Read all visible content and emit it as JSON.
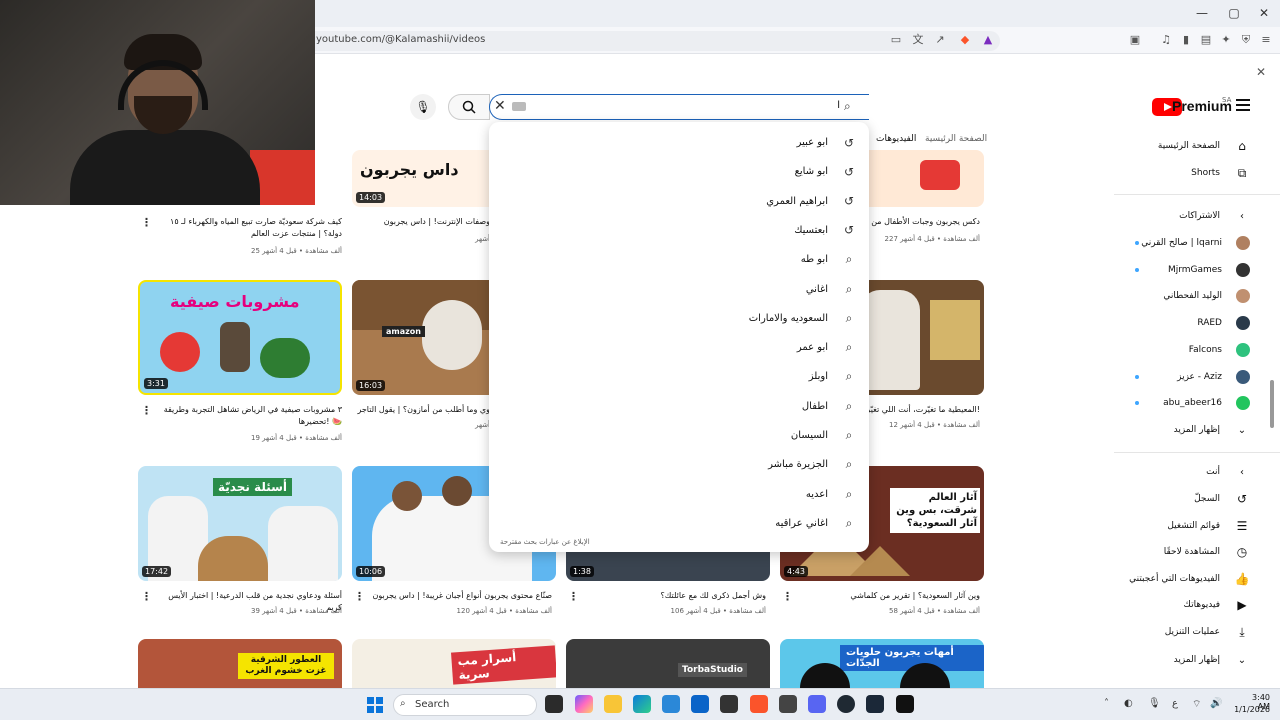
{
  "browser": {
    "url": "youtube.com/@Kalamashii/videos",
    "window_controls": [
      "—",
      "▢",
      "✕"
    ]
  },
  "header": {
    "brand": "Premium",
    "region": "SA",
    "search": {
      "value": "ا",
      "suggestions": [
        {
          "text": "ابو عبير",
          "icon": "history-icon"
        },
        {
          "text": "ابو شايع",
          "icon": "history-icon"
        },
        {
          "text": "ابراهيم العمري",
          "icon": "history-icon"
        },
        {
          "text": "ابعتسيك",
          "icon": "history-icon"
        },
        {
          "text": "ابو طه",
          "icon": "search-icon"
        },
        {
          "text": "اغاني",
          "icon": "search-icon"
        },
        {
          "text": "السعوديه والامارات",
          "icon": "search-icon"
        },
        {
          "text": "ابو عمر",
          "icon": "search-icon"
        },
        {
          "text": "اوبلز",
          "icon": "search-icon"
        },
        {
          "text": "اطفال",
          "icon": "search-icon"
        },
        {
          "text": "السيسان",
          "icon": "search-icon"
        },
        {
          "text": "الجزيرة مباشر",
          "icon": "search-icon"
        },
        {
          "text": "اعديه",
          "icon": "search-icon"
        },
        {
          "text": "اغاني عراقيه",
          "icon": "search-icon"
        }
      ],
      "report_link": "الإبلاغ عن عبارات بحث مقترحة"
    }
  },
  "tabs": {
    "home": "الصفحة الرئيسية",
    "videos": "الفيديوهات"
  },
  "sidebar": {
    "primary": [
      {
        "label": "الصفحة الرئيسية",
        "icon": "home-icon"
      },
      {
        "label": "Shorts",
        "icon": "shorts-icon"
      }
    ],
    "subscriptions_title": "الاشتراكات",
    "subscriptions": [
      {
        "label": "صالح القرني | lqarni",
        "color": "#b08060",
        "dot": true
      },
      {
        "label": "MjrmGames",
        "color": "#333333",
        "dot": true
      },
      {
        "label": "الوليد الفحطاني",
        "color": "#c09070",
        "dot": false
      },
      {
        "label": "RAED",
        "color": "#2a3a4a",
        "dot": false
      },
      {
        "label": "Falcons",
        "color": "#2ec27e",
        "dot": false
      },
      {
        "label": "عزيز - Aziz",
        "color": "#3a5a7a",
        "dot": true
      },
      {
        "label": "abu_abeer16",
        "color": "#22c55e",
        "dot": true
      }
    ],
    "subscriptions_more": "إظهار المزيد",
    "you_title": "أنت",
    "you": [
      {
        "label": "السجلّ",
        "icon": "history-icon"
      },
      {
        "label": "قوائم التشغيل",
        "icon": "playlist-icon"
      },
      {
        "label": "المشاهدة لاحقًا",
        "icon": "clock-icon"
      },
      {
        "label": "الفيديوهات التي أعجبتني",
        "icon": "thumbs-up-icon"
      },
      {
        "label": "فيديوهاتك",
        "icon": "video-icon"
      },
      {
        "label": "عمليات التنزيل",
        "icon": "download-icon"
      }
    ],
    "you_more": "إظهار المزيد"
  },
  "videos": [
    {
      "title": "دكس يجربون وجبات الأطفال من مطاعم",
      "meta": "227 ألف مشاهدة • قبل 4 أشهر",
      "duration": ""
    },
    {
      "title": "وصفات الإنترنت! | داس يجربون",
      "meta": "أشهر",
      "duration": "14:03"
    },
    {
      "title": "كيف شركة سعوديّة صارت تبيع المياه والكهرباء لـ ١٥ دولة؟ | منتجات عزت العالم",
      "meta": "25 ألف مشاهدة • قبل 4 أشهر",
      "duration": ""
    },
    {
      "title": "المعيطية ما تغيّرت، أنت اللي تغيّرت!",
      "meta": "12 ألف مشاهدة • قبل 4 أشهر",
      "duration": ""
    },
    {
      "title": "وي وما أطلب من أمازون؟ | يقول التاجر",
      "meta": "أشهر",
      "duration": "16:03"
    },
    {
      "title": "٣ مشروبات صيفية في الرياض تشاهل التجربة وطريقة تحضيرها! 🍉",
      "meta": "19 ألف مشاهدة • قبل 4 أشهر",
      "duration": "3:31"
    },
    {
      "title": "وين آثار السعودية؟ | تقرير من كلماشي",
      "meta": "58 ألف مشاهدة • قبل 4 أشهر",
      "duration": "4:43"
    },
    {
      "title": "وش أجمل ذكرى لك مع عائلتك؟",
      "meta": "106 ألف مشاهدة • قبل 4 أشهر",
      "duration": "1:38"
    },
    {
      "title": "صنّاع محتوى يجربون أنواع أجبان غريبة! | داس يجربون",
      "meta": "120 ألف مشاهدة • قبل 4 أشهر",
      "duration": "10:06"
    },
    {
      "title": "أسئلة ودعاوي نجدية من قلب الدرعية! | اختبار الأيس كريم",
      "meta": "39 ألف مشاهدة • قبل 4 أشهر",
      "duration": "17:42"
    }
  ],
  "thumb_texts": {
    "drinks": "مشروبات صيفية",
    "najdi": "أسئلة نجديّة",
    "athar": "آثار العالم شرقت، بس وين آثار السعودية؟",
    "das": "داس يجربون",
    "amazon": "amazon",
    "perfume": "العطور الشرقية غزت خشوم الغرب",
    "secret": "أسرار مب سرية",
    "torba": "TorbaStudio",
    "halawiyat": "أمهات يجربون حلويات الجدّات"
  },
  "taskbar": {
    "search_label": "Search",
    "time": "3:40 AM",
    "date": "1/1/2026",
    "lang": "ع"
  }
}
